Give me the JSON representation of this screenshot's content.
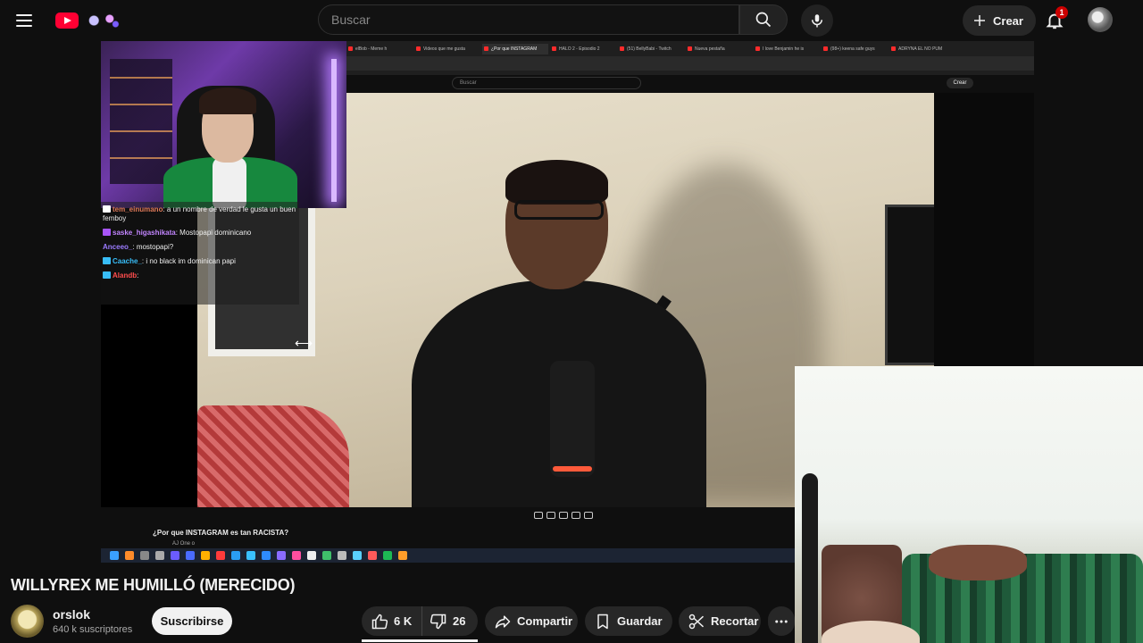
{
  "header": {
    "search_placeholder": "Buscar",
    "create_label": "Crear",
    "notification_count": "1"
  },
  "player": {
    "inner_search_placeholder": "Buscar",
    "inner_create_label": "Crear",
    "inner_video_title": "¿Por que INSTAGRAM es tan RACISTA?",
    "inner_channel": "AJ One o",
    "tabs": [
      "elBob - Meme h",
      "Videos que me gusta",
      "¿Por que INSTAGRAM",
      "HALO 2 - Episodio 2",
      "(51) BellyBabi - Twitch",
      "Nueva pestaña",
      "I love Benjamin he is",
      "(98+) keena safe guys",
      "ADRYNA EL NO PUM"
    ],
    "chat": [
      {
        "user": "tem_einumano",
        "message": "a un nombre de verdad le gusta un buen femboy",
        "user_color": "#e07a5a",
        "badge_color": "#ffffff"
      },
      {
        "user": "saske_higashikata",
        "message": "Mostopapi dominicano",
        "user_color": "#c084fc",
        "badge_color": "#a855f7"
      },
      {
        "user": "Anceeo_",
        "message": "mostopapi?",
        "user_color": "#9b7bff",
        "badge_color": ""
      },
      {
        "user": "Caache_",
        "message": "i no black im dominican papi",
        "user_color": "#38bdf8",
        "badge_color": "#38bdf8"
      },
      {
        "user": "Alandb",
        "message": "",
        "user_color": "#ff4d4d",
        "badge_color": "#38bdf8"
      }
    ]
  },
  "video": {
    "title": "WILLYREX ME HUMILLÓ (MERECIDO)"
  },
  "channel": {
    "name": "orslok",
    "subscribers": "640 k suscriptores",
    "subscribe_label": "Suscribirse"
  },
  "actions": {
    "likes": "6 K",
    "dislikes": "26",
    "share_label": "Compartir",
    "save_label": "Guardar",
    "clip_label": "Recortar"
  },
  "colors": {
    "background": "#0f0f0f",
    "brand_red": "#ff0033",
    "pill": "#272727",
    "subscribe_bg": "#f1f1f1"
  }
}
